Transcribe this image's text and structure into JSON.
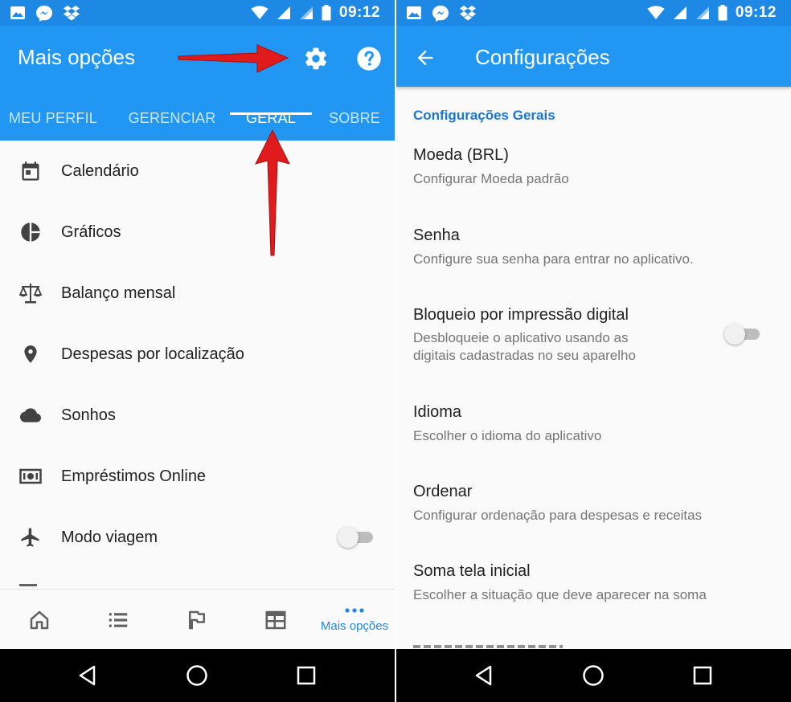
{
  "left": {
    "status_time": "09:12",
    "title": "Mais opções",
    "tabs": [
      {
        "label": "MEU PERFIL"
      },
      {
        "label": "GERENCIAR"
      },
      {
        "label": "GERAL"
      },
      {
        "label": "SOBRE"
      }
    ],
    "menu": [
      {
        "label": "Calendário",
        "icon": "calendar-icon"
      },
      {
        "label": "Gráficos",
        "icon": "pie-chart-icon"
      },
      {
        "label": "Balanço mensal",
        "icon": "scale-icon"
      },
      {
        "label": "Despesas por localização",
        "icon": "location-pin-icon"
      },
      {
        "label": "Sonhos",
        "icon": "cloud-icon"
      },
      {
        "label": "Empréstimos Online",
        "icon": "money-icon"
      },
      {
        "label": "Modo viagem",
        "icon": "airplane-icon"
      }
    ],
    "bottom_nav": {
      "active_label": "Mais opções"
    }
  },
  "right": {
    "status_time": "09:12",
    "title": "Configurações",
    "section": "Configurações Gerais",
    "settings": [
      {
        "title": "Moeda (BRL)",
        "subtitle": "Configurar Moeda padrão"
      },
      {
        "title": "Senha",
        "subtitle": "Configure sua senha para entrar no aplicativo."
      },
      {
        "title": "Bloqueio por impressão digital",
        "subtitle_line1": "Desbloqueie o aplicativo usando as",
        "subtitle_line2": "digitais cadastradas no seu aparelho"
      },
      {
        "title": "Idioma",
        "subtitle": "Escolher o idioma do aplicativo"
      },
      {
        "title": "Ordenar",
        "subtitle": "Configurar ordenação para despesas e receitas"
      },
      {
        "title": "Soma tela inicial",
        "subtitle": "Escolher a situação que deve aparecer na soma"
      }
    ]
  },
  "colors": {
    "app_bar": "#2196f3",
    "status_bar": "#1e88e5",
    "accent": "#1976d2",
    "annotation_arrow": "#e01b1b"
  }
}
